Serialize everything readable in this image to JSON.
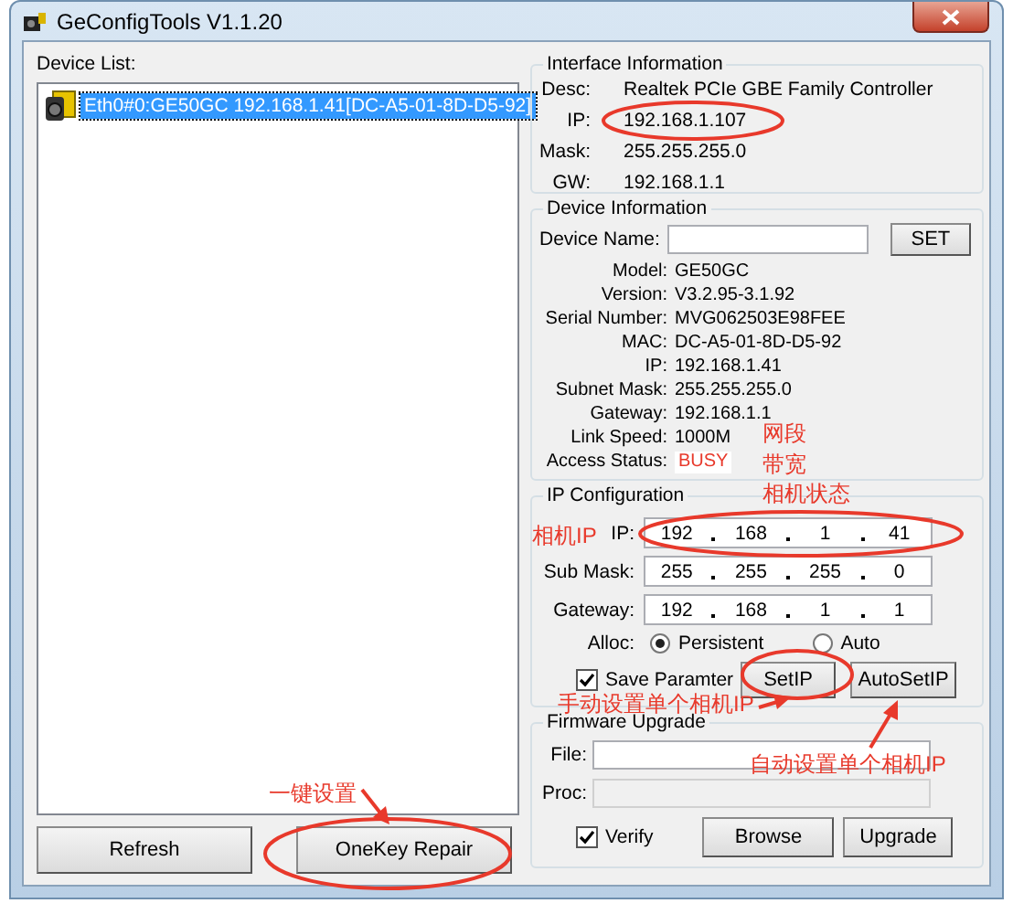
{
  "window": {
    "title": "GeConfigTools V1.1.20"
  },
  "device_list": {
    "label": "Device List:",
    "items": [
      {
        "label": "Eth0#0:GE50GC 192.168.1.41[DC-A5-01-8D-D5-92]",
        "selected": true
      }
    ],
    "buttons": [
      "Refresh",
      "OneKey Repair"
    ]
  },
  "interface_info": {
    "title": "Interface Information",
    "rows": [
      {
        "label": "Desc:",
        "value": "Realtek PCIe GBE Family Controller"
      },
      {
        "label": "IP:",
        "value": "192.168.1.107"
      },
      {
        "label": "Mask:",
        "value": "255.255.255.0"
      },
      {
        "label": "GW:",
        "value": "192.168.1.1"
      }
    ]
  },
  "device_info": {
    "title": "Device Information",
    "name_label": "Device Name:",
    "set_button": "SET",
    "rows": [
      {
        "label": "Model:",
        "value": "GE50GC",
        "kind": "text"
      },
      {
        "label": "Version:",
        "value": "V3.2.95-3.1.92",
        "kind": "text"
      },
      {
        "label": "Serial Number:",
        "value": "MVG062503E98FEE",
        "kind": "text"
      },
      {
        "label": "MAC:",
        "value": "DC-A5-01-8D-D5-92",
        "kind": "text"
      },
      {
        "label": "IP:",
        "value": "192.168.1.41",
        "kind": "text"
      },
      {
        "label": "Subnet Mask:",
        "value": "255.255.255.0",
        "kind": "text"
      },
      {
        "label": "Gateway:",
        "value": "192.168.1.1",
        "kind": "text"
      },
      {
        "label": "Link Speed:",
        "value": "1000M",
        "kind": "text"
      },
      {
        "label": "Access Status:",
        "value": "BUSY",
        "kind": "status"
      }
    ]
  },
  "ip_config": {
    "title": "IP Configuration",
    "fields": [
      {
        "label": "IP:",
        "octets": [
          "192",
          "168",
          "1",
          "41"
        ]
      },
      {
        "label": "Sub Mask:",
        "octets": [
          "255",
          "255",
          "255",
          "0"
        ]
      },
      {
        "label": "Gateway:",
        "octets": [
          "192",
          "168",
          "1",
          "1"
        ]
      }
    ],
    "alloc": {
      "label": "Alloc:",
      "options": [
        {
          "label": "Persistent",
          "selected": true
        },
        {
          "label": "Auto",
          "selected": false
        }
      ]
    },
    "save_param": {
      "label": "Save Paramter",
      "checked": true
    },
    "buttons": [
      "SetIP",
      "AutoSetIP"
    ]
  },
  "firmware": {
    "title": "Firmware Upgrade",
    "fields": [
      {
        "label": "File:",
        "disabled": false
      },
      {
        "label": "Proc:",
        "disabled": true
      }
    ],
    "verify": {
      "label": "Verify",
      "checked": true
    },
    "buttons": [
      "Browse",
      "Upgrade"
    ]
  },
  "annotations": [
    {
      "text": "网段"
    },
    {
      "text": "带宽"
    },
    {
      "text": "相机状态"
    },
    {
      "text": "相机IP"
    },
    {
      "text": "手动设置单个相机IP"
    },
    {
      "text": "自动设置单个相机IP"
    },
    {
      "text": "一键设置"
    }
  ]
}
